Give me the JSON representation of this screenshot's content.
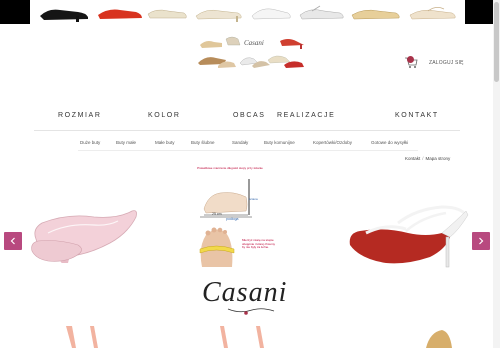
{
  "header": {
    "login_label": "ZALOGUJ SIĘ",
    "cart_count": "0"
  },
  "main_nav": [
    {
      "label": "ROZMIAR"
    },
    {
      "label": "KOLOR"
    },
    {
      "label": "OBCAS"
    },
    {
      "label": "REALIZACJE"
    },
    {
      "label": "KONTAKT"
    }
  ],
  "sub_nav": [
    {
      "label": "Duże buty"
    },
    {
      "label": "Buty małe"
    },
    {
      "label": "Małe buty"
    },
    {
      "label": "Buty ślubne"
    },
    {
      "label": "Sandały"
    },
    {
      "label": "Buty komunijne"
    },
    {
      "label": "Kopertówki/Ozdoby"
    },
    {
      "label": "Gotowe do wysyłki"
    }
  ],
  "breadcrumb": {
    "contact": "Kontakt",
    "sitemap": "Mapa strony"
  },
  "slider": {
    "measure_caption": "Prawidłowe mierzenie długości stopy przy ścianie",
    "measure_length": "25 cm",
    "measure_floor": "podłoga",
    "measure_wall": "ściana",
    "measure_note": "Mierzyć miarę na stopie obojętnie i której chcemy by nie były za luźne.",
    "brand": "Casani"
  },
  "colors": {
    "accent": "#b8497f",
    "badge": "#a8324a",
    "shoe_red": "#c0392b",
    "shoe_pink": "#f2c9d3",
    "shoe_gold": "#d4b067"
  }
}
